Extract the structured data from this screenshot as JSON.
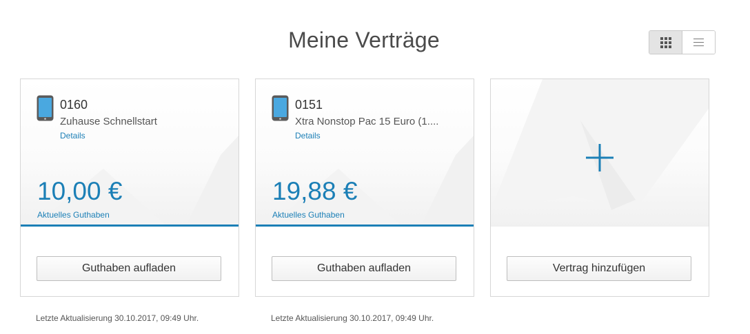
{
  "page": {
    "title": "Meine Verträge"
  },
  "view_toggle": {
    "grid_icon": "grid-icon",
    "list_icon": "list-icon",
    "active": "grid"
  },
  "contracts": [
    {
      "number": "0160",
      "plan": "Zuhause Schnellstart",
      "details_label": "Details",
      "amount": "10,00 €",
      "amount_label": "Aktuelles Guthaben",
      "button_label": "Guthaben aufladen",
      "updated": "Letzte Aktualisierung 30.10.2017, 09:49 Uhr."
    },
    {
      "number": "0151",
      "plan": "Xtra Nonstop Pac 15 Euro (1....",
      "details_label": "Details",
      "amount": "19,88 €",
      "amount_label": "Aktuelles Guthaben",
      "button_label": "Guthaben aufladen",
      "updated": "Letzte Aktualisierung 30.10.2017, 09:49 Uhr."
    }
  ],
  "add_card": {
    "icon": "plus-icon",
    "button_label": "Vertrag hinzufügen"
  },
  "colors": {
    "accent": "#1b7fb6",
    "title": "#4a4a4a"
  }
}
